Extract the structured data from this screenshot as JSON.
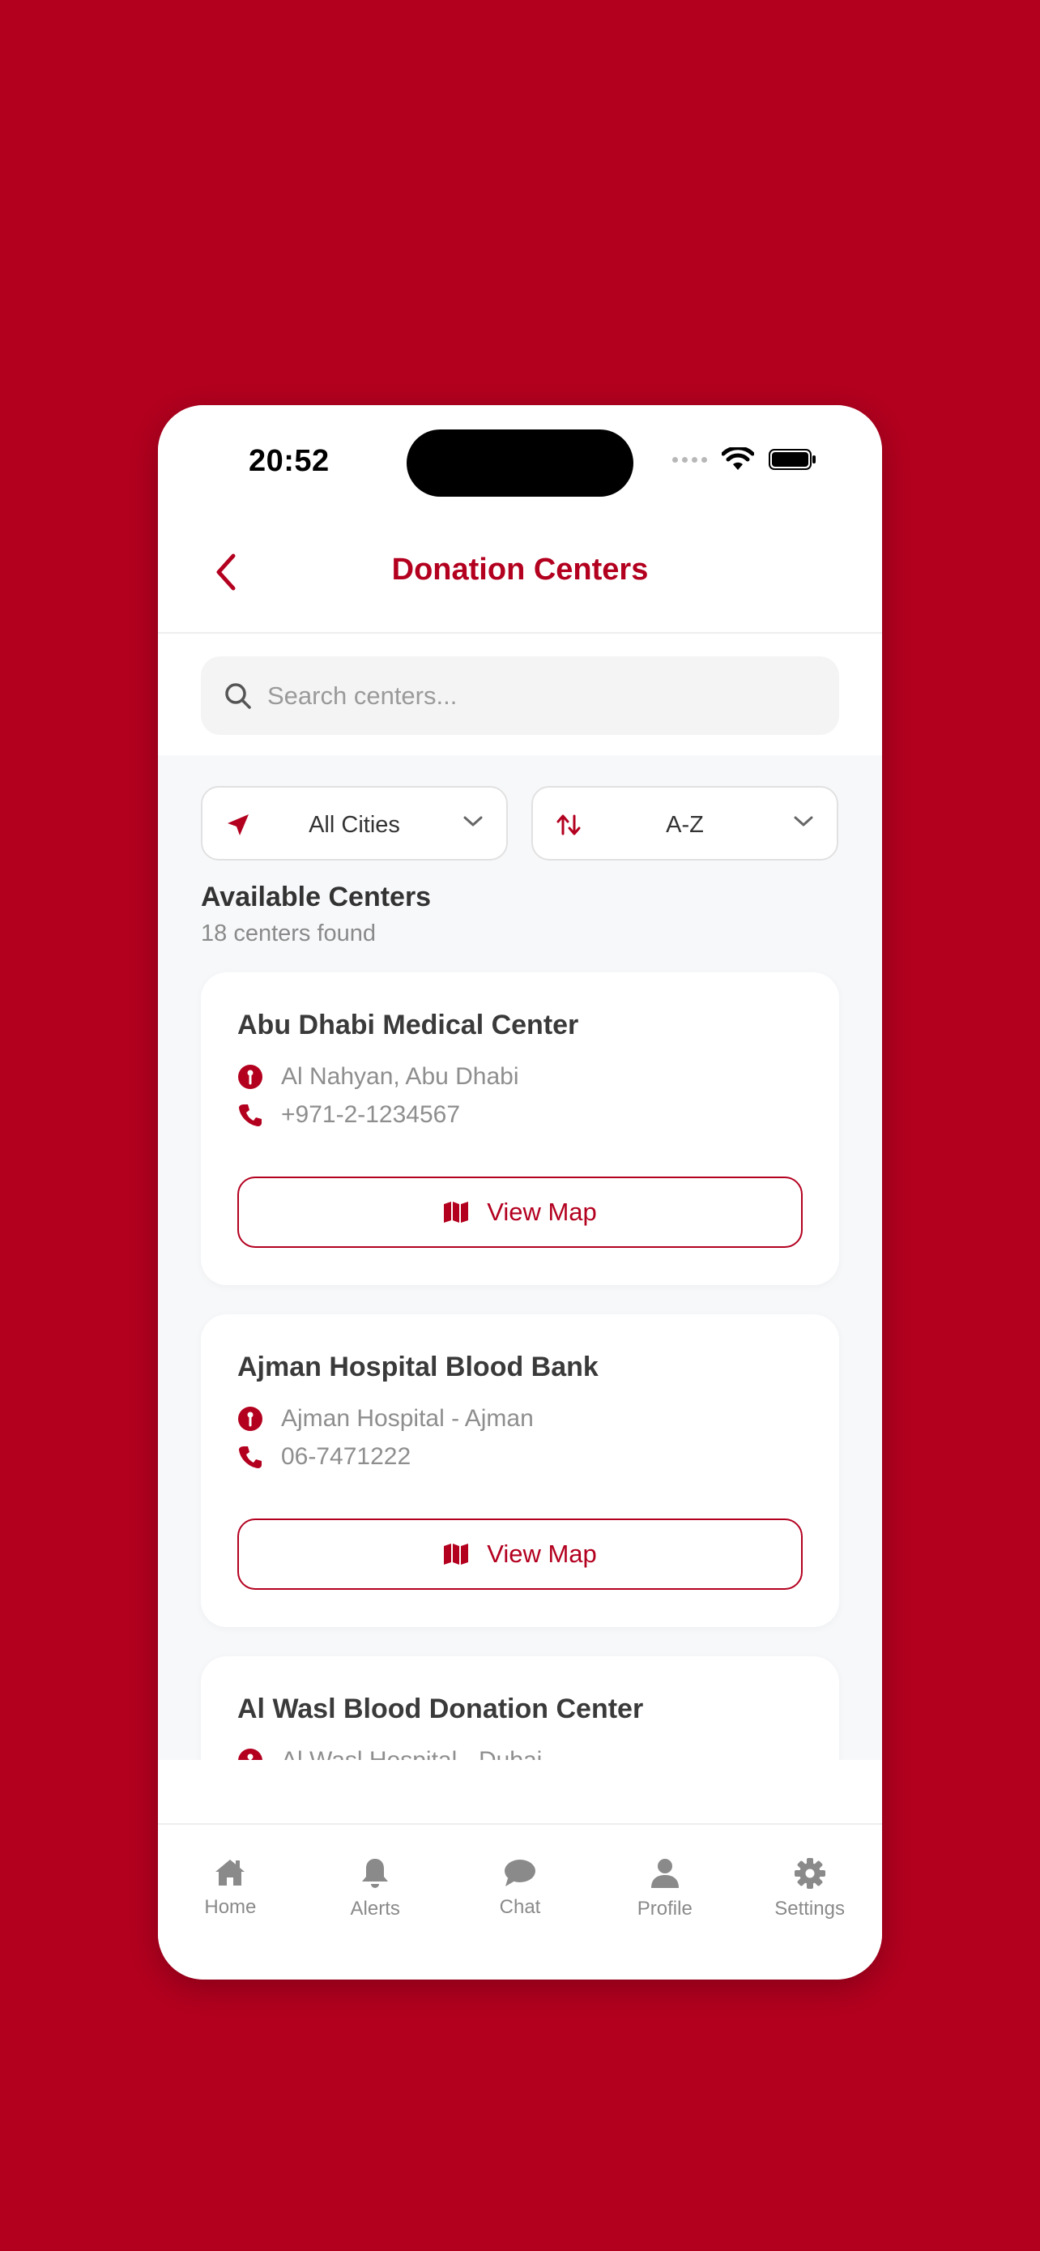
{
  "status_bar": {
    "time": "20:52"
  },
  "header": {
    "title": "Donation Centers"
  },
  "search": {
    "placeholder": "Search centers..."
  },
  "filters": {
    "city": "All Cities",
    "sort": "A-Z"
  },
  "section": {
    "title": "Available Centers",
    "count_text": "18 centers found"
  },
  "centers": [
    {
      "name": "Abu Dhabi Medical Center",
      "address": "Al Nahyan, Abu Dhabi",
      "phone": "+971-2-1234567",
      "button": "View Map"
    },
    {
      "name": "Ajman Hospital Blood Bank",
      "address": "Ajman Hospital - Ajman",
      "phone": "06-7471222",
      "button": "View Map"
    },
    {
      "name": "Al Wasl Blood Donation Center",
      "address": "Al Wasl Hospital - Dubai"
    }
  ],
  "nav": [
    {
      "label": "Home",
      "icon": "home-icon"
    },
    {
      "label": "Alerts",
      "icon": "bell-icon"
    },
    {
      "label": "Chat",
      "icon": "chat-icon"
    },
    {
      "label": "Profile",
      "icon": "user-icon"
    },
    {
      "label": "Settings",
      "icon": "gear-icon"
    }
  ],
  "colors": {
    "brand": "#B3001F",
    "background": "#F7F8FA",
    "muted": "#8A8A8A"
  }
}
